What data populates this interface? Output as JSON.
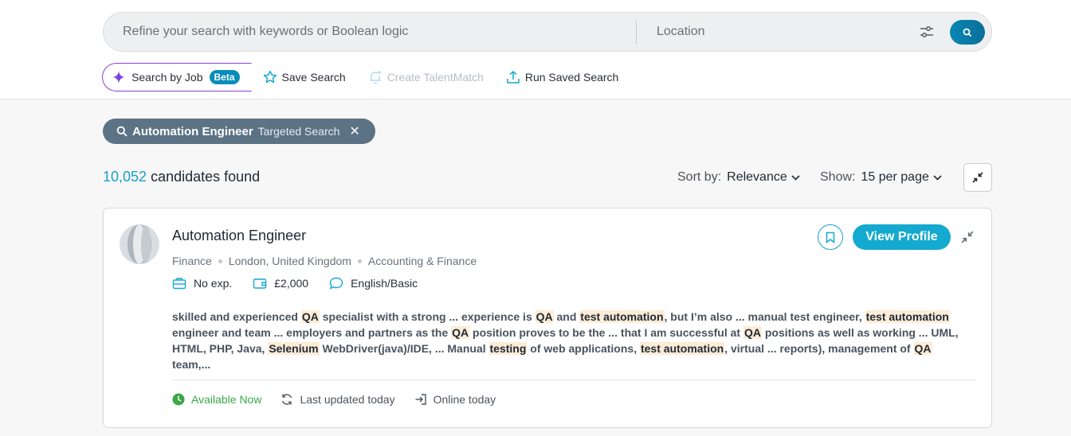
{
  "search": {
    "keywords_placeholder": "Refine your search with keywords or Boolean logic",
    "keywords_value": "",
    "location_placeholder": "Location",
    "location_value": ""
  },
  "toolbar": {
    "search_by_job": "Search by Job",
    "beta_badge": "Beta",
    "save_search": "Save Search",
    "create_talentmatch": "Create TalentMatch",
    "run_saved_search": "Run Saved Search"
  },
  "active_filter": {
    "term": "Automation Engineer",
    "type": "Targeted Search",
    "close": "✕"
  },
  "results": {
    "count": "10,052",
    "count_suffix": "candidates found",
    "sort_label": "Sort by:",
    "sort_value": "Relevance",
    "show_label": "Show:",
    "show_value": "15 per page"
  },
  "candidate": {
    "title": "Automation Engineer",
    "industry": "Finance",
    "location": "London, United Kingdom",
    "sector": "Accounting & Finance",
    "experience": "No exp.",
    "salary": "£2,000",
    "language": "English/Basic",
    "view_profile": "View Profile",
    "snippet_parts": [
      {
        "t": "skilled and experienced ",
        "h": false
      },
      {
        "t": "QA",
        "h": true
      },
      {
        "t": " specialist with a strong ... experience is ",
        "h": false
      },
      {
        "t": "QA",
        "h": true
      },
      {
        "t": " and ",
        "h": false
      },
      {
        "t": "test automation",
        "h": true
      },
      {
        "t": ", but I’m also ... manual test engineer, ",
        "h": false
      },
      {
        "t": "test automation",
        "h": true
      },
      {
        "t": " engineer and team ... employers and partners as the ",
        "h": false
      },
      {
        "t": "QA",
        "h": true
      },
      {
        "t": " position proves to be the ... that I am successful at ",
        "h": false
      },
      {
        "t": "QA",
        "h": true
      },
      {
        "t": " positions as well as working ... UML, HTML, PHP, Java, ",
        "h": false
      },
      {
        "t": "Selenium",
        "h": true
      },
      {
        "t": " WebDriver(java)/IDE, ... Manual ",
        "h": false
      },
      {
        "t": "testing",
        "h": true
      },
      {
        "t": " of web applications, ",
        "h": false
      },
      {
        "t": "test automation",
        "h": true
      },
      {
        "t": ", virtual ... reports), management of ",
        "h": false
      },
      {
        "t": "QA",
        "h": true
      },
      {
        "t": " team,...",
        "h": false
      }
    ],
    "availability": "Available Now",
    "last_updated": "Last updated today",
    "online": "Online today"
  },
  "colors": {
    "accent": "#14a9cf",
    "chip": "#5c7386",
    "highlight": "#fdecd6",
    "available": "#3aa847",
    "beta": "#0b8db9",
    "ai_purple": "#8b3fd6"
  },
  "icons": {
    "filter": "sliders-icon",
    "search": "search-icon",
    "ai": "sparkle-icon",
    "save": "star-icon",
    "talentmatch": "bell-plus-icon",
    "run": "upload-icon",
    "collapse": "collapse-arrows-icon",
    "bookmark": "bookmark-icon",
    "briefcase": "briefcase-icon",
    "wallet": "wallet-icon",
    "chat": "chat-bubble-icon",
    "clock": "clock-icon",
    "refresh": "refresh-icon",
    "login": "login-arrow-icon"
  }
}
